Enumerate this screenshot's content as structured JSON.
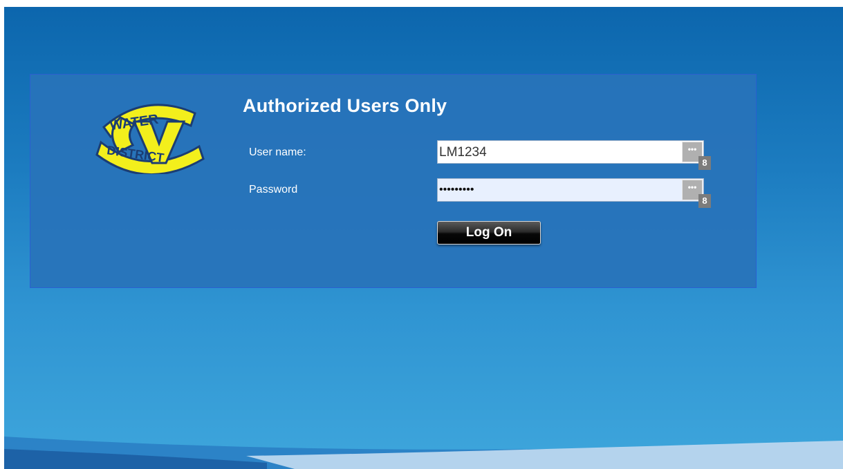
{
  "heading": "Authorized Users Only",
  "logo": {
    "top_text": "WATER",
    "letter": "V",
    "bottom_text": "DISTRICT",
    "colors": {
      "fill": "#f3ef1c",
      "outline": "#1b3d73"
    }
  },
  "form": {
    "username_label": "User name:",
    "username_value": "LM1234",
    "password_label": "Password",
    "password_masked": "•••••••••",
    "password_manager_button": "•••",
    "password_manager_badge": "8",
    "logon_label": "Log On"
  },
  "colors": {
    "background_top": "#0c66ad",
    "background_bottom": "#3ea6dc",
    "panel": "#2873ba",
    "panel_border": "#2a5fd1"
  }
}
